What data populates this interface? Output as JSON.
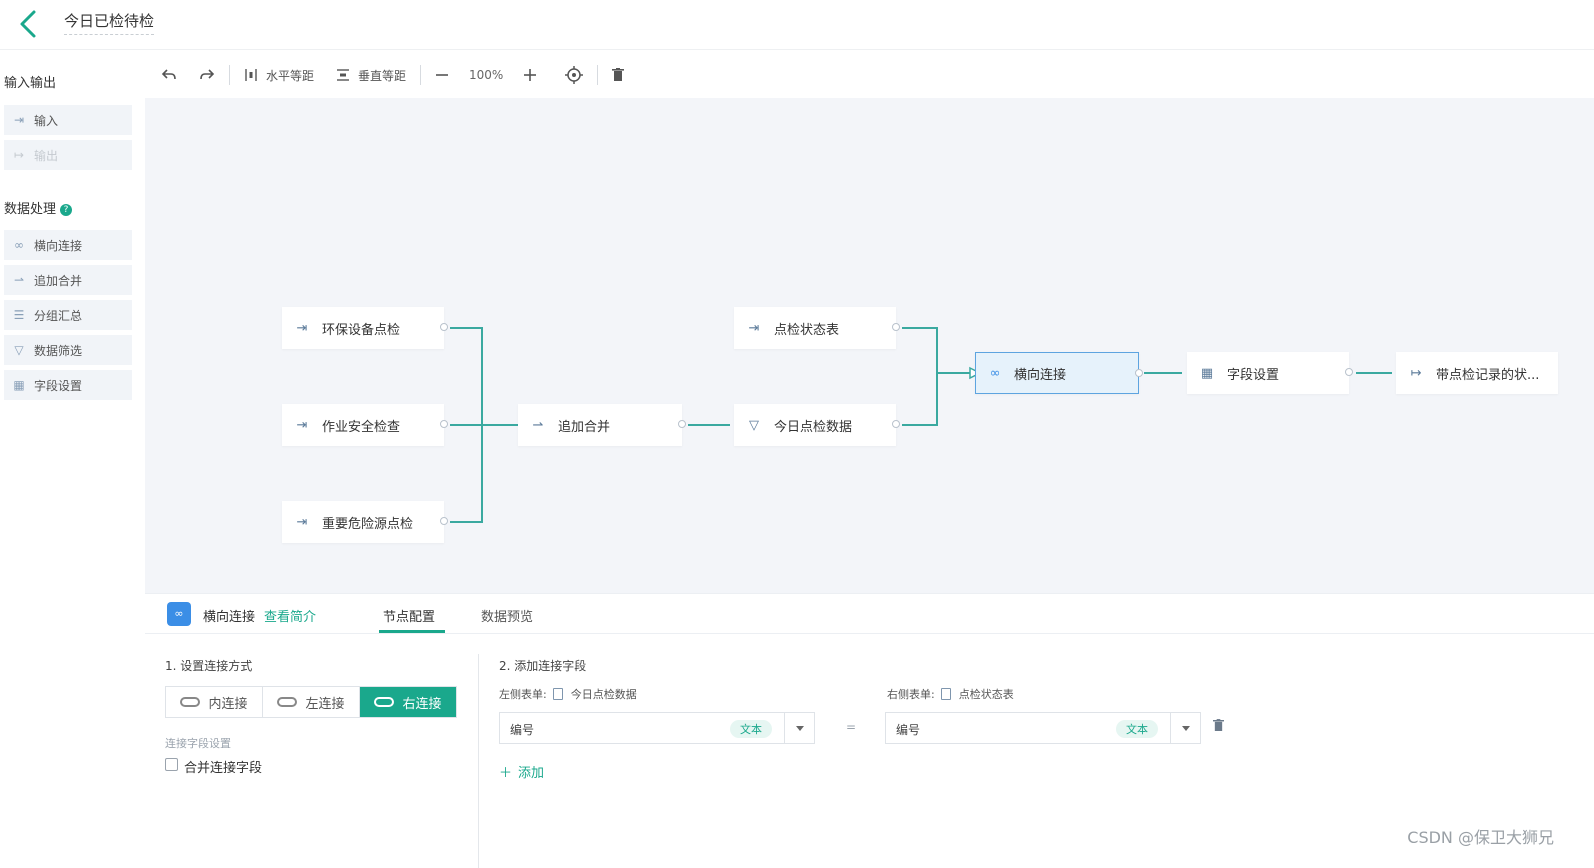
{
  "header": {
    "title": "今日已检待检"
  },
  "sidebar": {
    "section_io": "输入输出",
    "io_items": [
      {
        "label": "输入",
        "icon": "input-icon"
      },
      {
        "label": "输出",
        "icon": "output-icon"
      }
    ],
    "section_proc": "数据处理",
    "proc_items": [
      {
        "label": "横向连接",
        "icon": "link-icon"
      },
      {
        "label": "追加合并",
        "icon": "merge-icon"
      },
      {
        "label": "分组汇总",
        "icon": "group-icon"
      },
      {
        "label": "数据筛选",
        "icon": "filter-icon"
      },
      {
        "label": "字段设置",
        "icon": "table-icon"
      }
    ]
  },
  "toolbar": {
    "h_distribute": "水平等距",
    "v_distribute": "垂直等距",
    "zoom": "100%"
  },
  "canvas": {
    "nodes": {
      "env": "环保设备点检",
      "safety": "作业安全检查",
      "hazard": "重要危险源点检",
      "append": "追加合并",
      "status_table": "点检状态表",
      "today_data": "今日点检数据",
      "join": "横向连接",
      "field_set": "字段设置",
      "output": "带点检记录的状..."
    }
  },
  "panel": {
    "node_name": "横向连接",
    "intro_link": "查看简介",
    "tabs": [
      "节点配置",
      "数据预览"
    ],
    "step1_title": "1. 设置连接方式",
    "join_types": [
      "内连接",
      "左连接",
      "右连接"
    ],
    "selected_join": "右连接",
    "field_settings_label": "连接字段设置",
    "merge_checkbox_label": "合并连接字段",
    "step2_title": "2. 添加连接字段",
    "left_table_label": "左侧表单:",
    "left_table_name": "今日点检数据",
    "right_table_label": "右侧表单:",
    "right_table_name": "点检状态表",
    "left_field": "编号",
    "left_field_type": "文本",
    "right_field": "编号",
    "right_field_type": "文本",
    "equals": "=",
    "add_label": "添加"
  },
  "watermark": "CSDN @保卫大狮兄",
  "colors": {
    "accent": "#1aa88c",
    "edge": "#3aa9a0",
    "selected": "#5da4e0"
  }
}
